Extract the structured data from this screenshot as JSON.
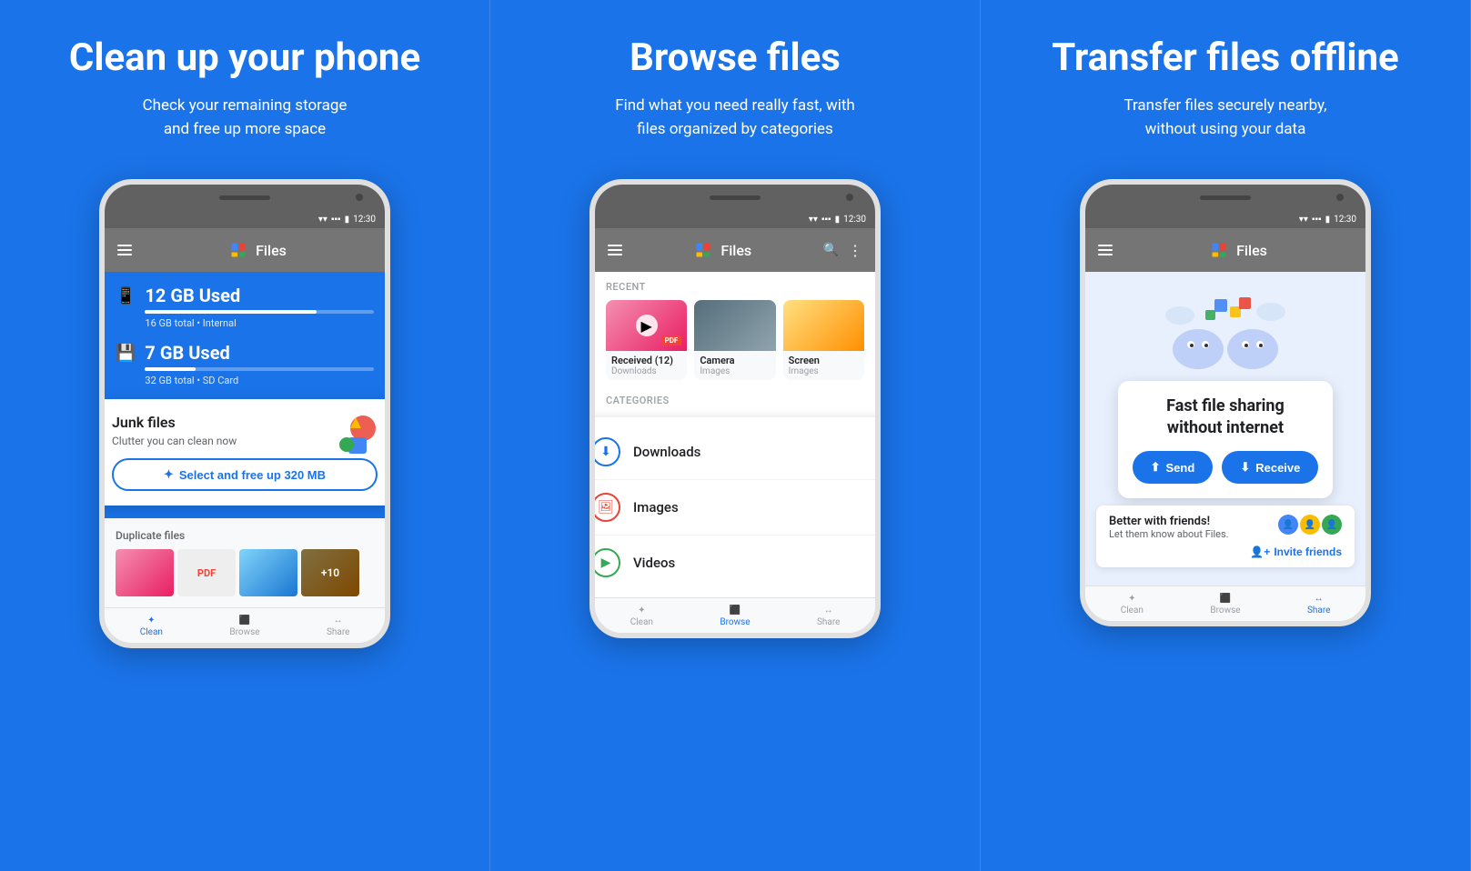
{
  "panels": [
    {
      "id": "panel-1",
      "title": "Clean up your phone",
      "subtitle": "Check your remaining storage\nand free up more space",
      "phone": {
        "appBarTitle": "Files",
        "time": "12:30",
        "storageItems": [
          {
            "used": "12 GB Used",
            "total": "16 GB total • Internal",
            "percent": 75
          },
          {
            "used": "7 GB Used",
            "total": "32 GB total • SD Card",
            "percent": 22
          }
        ],
        "junkCard": {
          "title": "Junk files",
          "subtitle": "Clutter you can clean now",
          "buttonLabel": "Select and free up 320 MB"
        },
        "dupSection": "Duplicate files"
      },
      "navItems": [
        "Clean",
        "Browse",
        "Share"
      ]
    },
    {
      "id": "panel-2",
      "title": "Browse files",
      "subtitle": "Find what you need really fast, with\nfiles organized by categories",
      "phone": {
        "appBarTitle": "Files",
        "time": "12:30",
        "recentLabel": "RECENT",
        "recentItems": [
          {
            "name": "Received (12)",
            "type": "Downloads"
          },
          {
            "name": "Camera",
            "type": "Images"
          },
          {
            "name": "Screen",
            "type": "Images"
          }
        ],
        "categoriesLabel": "CATEGORIES",
        "categories": [
          {
            "name": "Downloads",
            "icon": "⬇"
          },
          {
            "name": "Images",
            "icon": "🖼"
          },
          {
            "name": "Videos",
            "icon": "📅"
          }
        ]
      },
      "navItems": [
        "Clean",
        "Browse",
        "Share"
      ],
      "activeNav": "Browse"
    },
    {
      "id": "panel-3",
      "title": "Transfer files offline",
      "subtitle": "Transfer files securely nearby,\nwithout using your data",
      "phone": {
        "appBarTitle": "Files",
        "time": "12:30",
        "sharingCard": {
          "title": "Fast file sharing\nwithout internet",
          "sendLabel": "Send",
          "receiveLabel": "Receive"
        },
        "friendsCard": {
          "title": "Better with friends!",
          "subtitle": "Let them know about Files.",
          "buttonLabel": "Invite friends"
        }
      },
      "navItems": [
        "Clean",
        "Browse",
        "Share"
      ],
      "activeNav": "Share"
    }
  ],
  "colors": {
    "background": "#1a73e8",
    "appBar": "#757575",
    "statusBar": "#616161",
    "accent": "#1a73e8",
    "white": "#ffffff"
  }
}
